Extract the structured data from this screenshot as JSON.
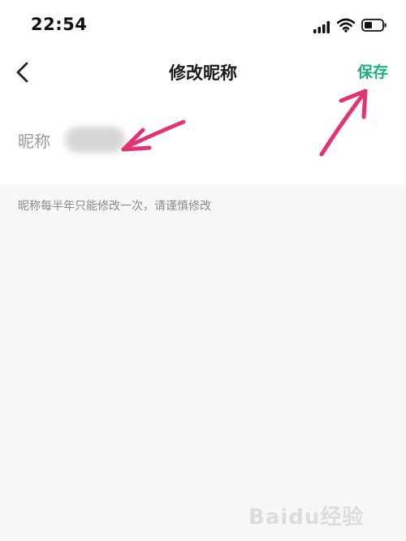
{
  "status_bar": {
    "time": "22:54"
  },
  "nav": {
    "title": "修改昵称",
    "save_label": "保存"
  },
  "form": {
    "nickname_label": "昵称",
    "nickname_value": "",
    "hint": "昵称每半年只能修改一次，请谨慎修改"
  },
  "colors": {
    "accent": "#1eb07a",
    "annotation_arrow": "#e23472"
  },
  "watermark": {
    "text": "Baidu经验"
  }
}
